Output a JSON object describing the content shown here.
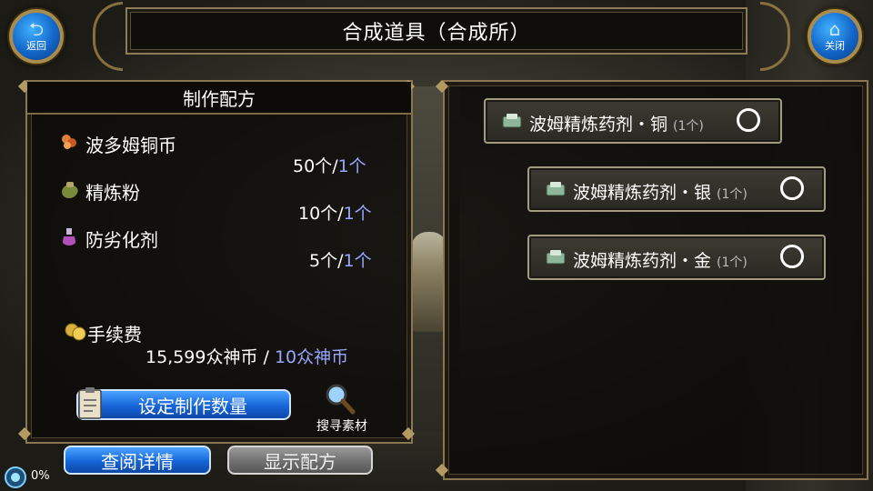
{
  "title": "合成道具（合成所）",
  "back_button": {
    "label": "返回",
    "icon": "back-arrow-icon"
  },
  "close_button": {
    "label": "关闭",
    "icon": "home-icon"
  },
  "recipe_panel": {
    "header": "制作配方",
    "ingredients": [
      {
        "name": "波多姆铜币",
        "required": "50个",
        "separator": "/",
        "owned": "1个",
        "icon": "coins-icon"
      },
      {
        "name": "精炼粉",
        "required": "10个",
        "separator": "/",
        "owned": "1个",
        "icon": "powder-bag-icon"
      },
      {
        "name": "防劣化剂",
        "required": "5个",
        "separator": "/",
        "owned": "1个",
        "icon": "potion-flask-icon"
      }
    ],
    "fee": {
      "label": "手续费",
      "value": "15,599众神币",
      "separator": " / ",
      "required": "10众神币",
      "icon": "gold-coins-icon"
    },
    "set_quantity_button": "设定制作数量",
    "search_materials_label": "搜寻素材"
  },
  "bottom_buttons": {
    "details": "查阅详情",
    "show_recipe": "显示配方"
  },
  "status": {
    "percent": "0%"
  },
  "recipes": [
    {
      "name": "波姆精炼药剂・铜",
      "qty": "(1个)"
    },
    {
      "name": "波姆精炼药剂・银",
      "qty": "(1个)"
    },
    {
      "name": "波姆精炼药剂・金",
      "qty": "(1个)"
    }
  ],
  "colors": {
    "accent_blue": "#1665d8",
    "owned_text": "#9aa6ff",
    "frame_gold": "#8a7650"
  }
}
